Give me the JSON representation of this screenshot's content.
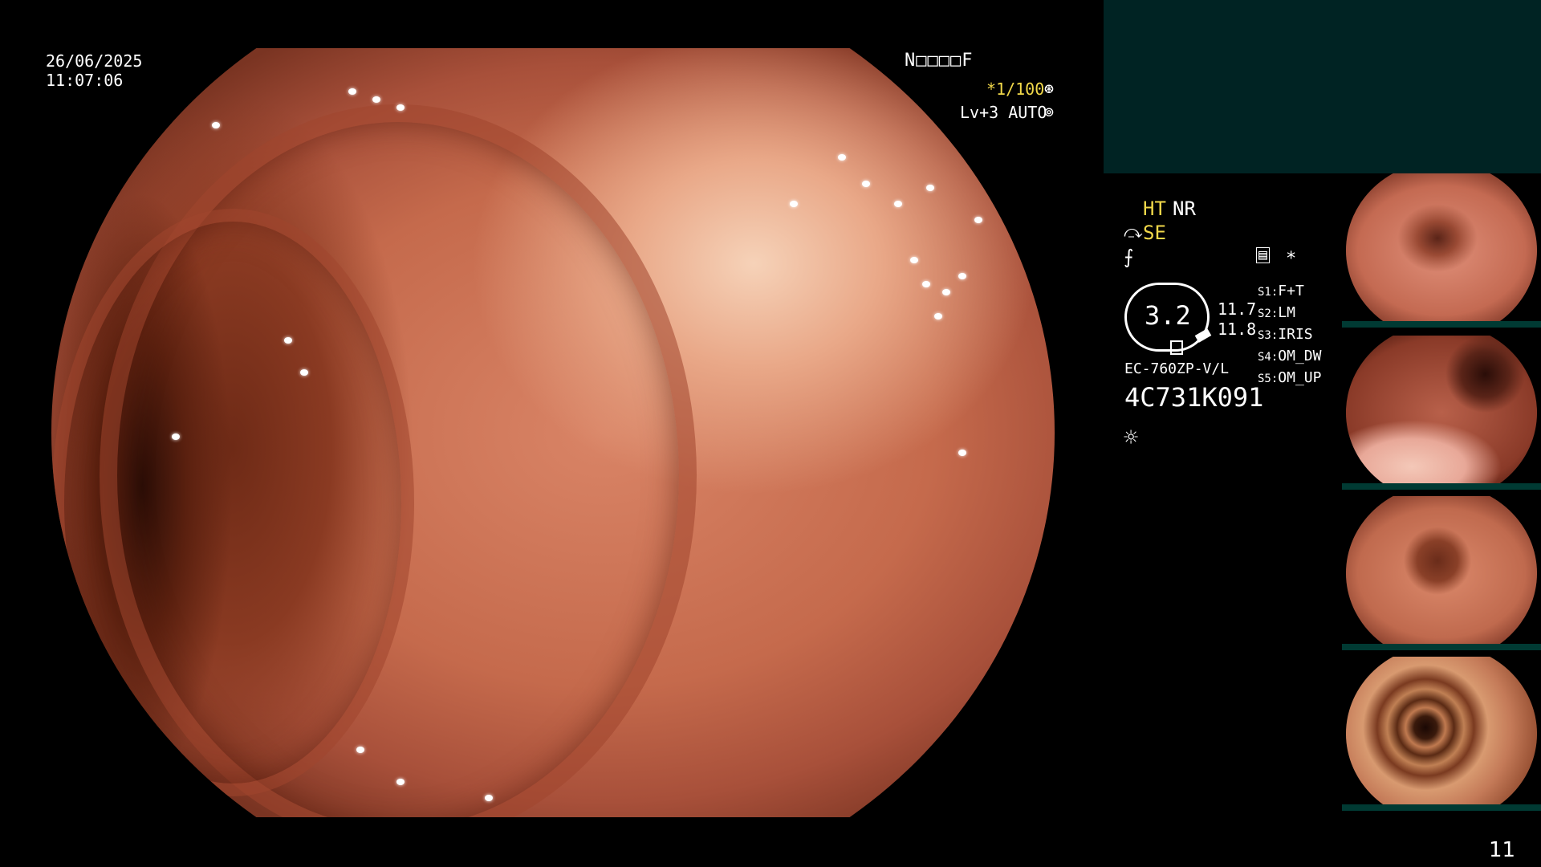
{
  "overlay": {
    "date": "26/06/2025",
    "time": "11:07:06",
    "patient_box": "N□□□□F",
    "shutter": "*1/100",
    "shutter_icon": "⊛",
    "level": "Lv+3 AUTO",
    "level_icon": "⊚"
  },
  "settings": {
    "ht": "HT",
    "nr": "NR",
    "se": "SE",
    "se_icon": "⤼",
    "f_icon": "⨍",
    "memory_icon": "▤",
    "star": "*",
    "gauge_value": "3.2",
    "gauge_side_1": "11.7",
    "gauge_side_2": "11.8",
    "scope_model": "EC-760ZP-V/L",
    "serial": "4C731K091",
    "light_icon": "☼"
  },
  "switches": [
    {
      "key": "S1:",
      "value": "F+T"
    },
    {
      "key": "S2:",
      "value": "LM"
    },
    {
      "key": "S3:",
      "value": "IRIS"
    },
    {
      "key": "S4:",
      "value": "OM_DW"
    },
    {
      "key": "S5:",
      "value": "OM_UP"
    }
  ],
  "colors": {
    "highlight": "#f2d94a",
    "panel": "#002323",
    "text": "#ffffff"
  },
  "page_number": "11"
}
